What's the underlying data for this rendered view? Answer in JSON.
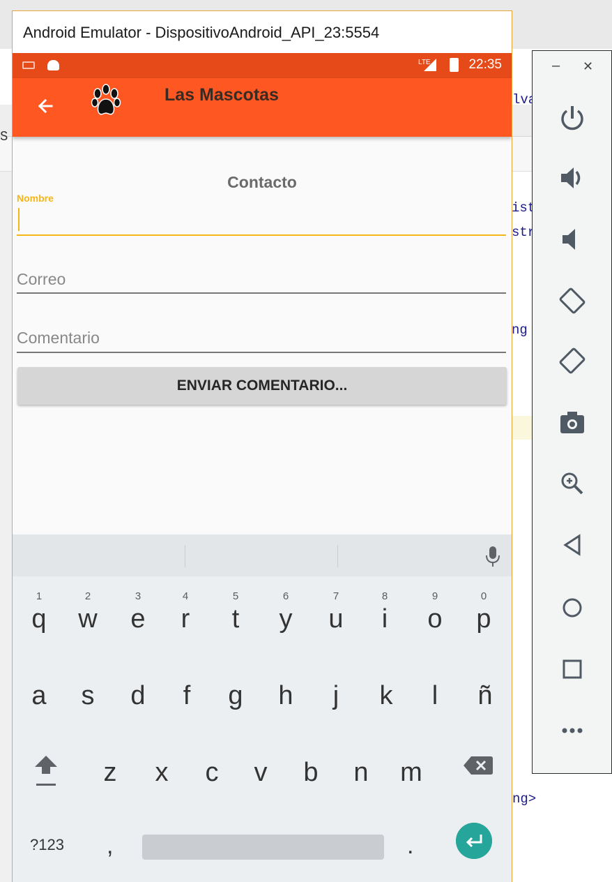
{
  "window": {
    "title": "Android Emulator - DispositivoAndroid_API_23:5554"
  },
  "statusbar": {
    "time": "22:35",
    "network": "LTE"
  },
  "toolbar": {
    "title": "Las Mascotas"
  },
  "form": {
    "title": "Contacto",
    "nombre_label": "Nombre",
    "nombre_value": "",
    "correo_placeholder": "Correo",
    "comentario_placeholder": "Comentario",
    "submit_label": "ENVIAR COMENTARIO..."
  },
  "keyboard": {
    "row1": [
      {
        "k": "q",
        "d": "1"
      },
      {
        "k": "w",
        "d": "2"
      },
      {
        "k": "e",
        "d": "3"
      },
      {
        "k": "r",
        "d": "4"
      },
      {
        "k": "t",
        "d": "5"
      },
      {
        "k": "y",
        "d": "6"
      },
      {
        "k": "u",
        "d": "7"
      },
      {
        "k": "i",
        "d": "8"
      },
      {
        "k": "o",
        "d": "9"
      },
      {
        "k": "p",
        "d": "0"
      }
    ],
    "row2": [
      "a",
      "s",
      "d",
      "f",
      "g",
      "h",
      "j",
      "k",
      "l",
      "ñ"
    ],
    "row3": [
      "z",
      "x",
      "c",
      "v",
      "b",
      "n",
      "m"
    ],
    "symbols_label": "?123",
    "comma": ",",
    "period": "."
  },
  "ide_fragments": {
    "f1": "ist",
    "f2": "str",
    "f3": "ng",
    "f4": "ng>",
    "f5": "lva",
    "f6": "S"
  },
  "colors": {
    "accent": "#ff5722",
    "status_bar": "#e64a19",
    "focus": "#f5b61a",
    "enter_key": "#26a69a"
  }
}
